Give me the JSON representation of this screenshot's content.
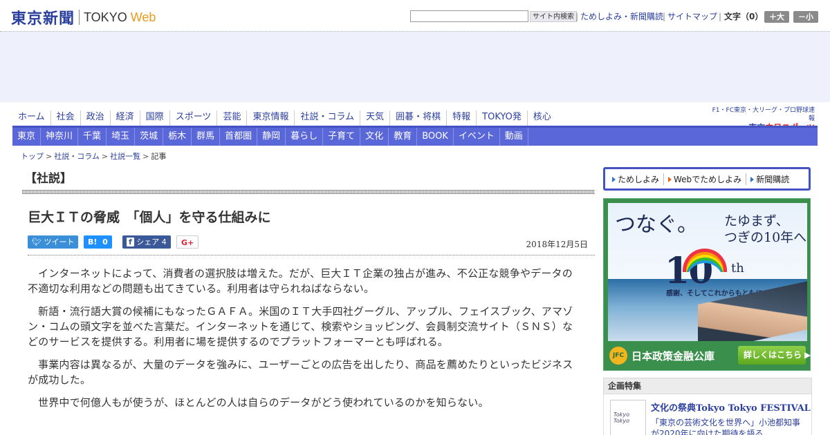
{
  "header": {
    "logo_jp": "東京新聞",
    "logo_tokyo": "TOKYO",
    "logo_web": "Web",
    "search_placeholder": "",
    "search_button": "サイト内検索",
    "links": [
      "ためしよみ・新聞購読",
      "サイトマップ"
    ],
    "font_size_label": "文字（0）",
    "font_larger": "＋大",
    "font_smaller": "－小"
  },
  "nav_primary": [
    "ホーム",
    "社会",
    "政治",
    "経済",
    "国際",
    "スポーツ",
    "芸能",
    "東京情報",
    "社説・コラム",
    "天気",
    "囲碁・将棋",
    "特報",
    "TOKYO発",
    "核心"
  ],
  "chunichi": {
    "top": "F1・FC東京・大リーグ・プロ野球速報",
    "main_pre": "東京",
    "main_brand": "中日スポーツ"
  },
  "nav_regional": [
    "東京",
    "神奈川",
    "千葉",
    "埼玉",
    "茨城",
    "栃木",
    "群馬",
    "首都圏",
    "静岡",
    "暮らし",
    "子育て",
    "文化",
    "教育",
    "BOOK",
    "イベント",
    "動画"
  ],
  "breadcrumb": {
    "items": [
      "トップ",
      "社説・コラム",
      "社説一覧"
    ],
    "current": "記事",
    "separator": ">"
  },
  "article": {
    "section": "【社説】",
    "headline": "巨大ＩＴの脅威　「個人」を守る仕組みに",
    "social": {
      "tweet": "ツイート",
      "hatena_icon": "B!",
      "hatena_count": "0",
      "fb_icon": "f",
      "fb_label": "シェア",
      "fb_count": "4",
      "gplus": "G+"
    },
    "date": "2018年12月5日",
    "paragraphs": [
      "インターネットによって、消費者の選択肢は増えた。だが、巨大ＩＴ企業の独占が進み、不公正な競争やデータの不適切な利用などの問題も出てきている。利用者は守られねばならない。",
      "新語・流行語大賞の候補にもなったＧＡＦＡ。米国のＩＴ大手四社グーグル、アップル、フェイスブック、アマゾン・コムの頭文字を並べた言葉だ。インターネットを通じて、検索やショッピング、会員制交流サイト（ＳＮＳ）などのサービスを提供する。利用者に場を提供するのでプラットフォーマーとも呼ばれる。",
      "事業内容は異なるが、大量のデータを強みに、ユーザーごとの広告を出したり、商品を薦めたりといったビジネスが成功した。",
      "世界中で何億人もが使うが、ほとんどの人は自らのデータがどう使われているのかを知らない。"
    ]
  },
  "sidebar": {
    "subscribe_links": [
      "ためしよみ",
      "Webでためしよみ",
      "新聞購読"
    ],
    "banner": {
      "line1": "つなぐ。",
      "line2a": "たゆまず、",
      "line2b": "つぎの10年へ",
      "ten": "10",
      "th": "th",
      "sub": "感謝、そしてこれからもともに。",
      "jfc_logo": "JFC",
      "org": "日本政策金融公庫",
      "button": "詳しくはこちら ▶"
    },
    "kikaku": {
      "heading": "企画特集",
      "thumb_text": "Tokyo Tokyo",
      "title_pre": "文化の祭典",
      "title_en": "Tokyo Tokyo FESTIVAL",
      "text": "「東京の芸術文化を世界へ」小池都知事が2020年に向けた期待を語る"
    }
  },
  "colors": {
    "brand_blue": "#2b3f9e",
    "nav_blue": "#5a67d8",
    "accent_orange": "#e89a1b",
    "ad_band": "#eef0fb"
  }
}
